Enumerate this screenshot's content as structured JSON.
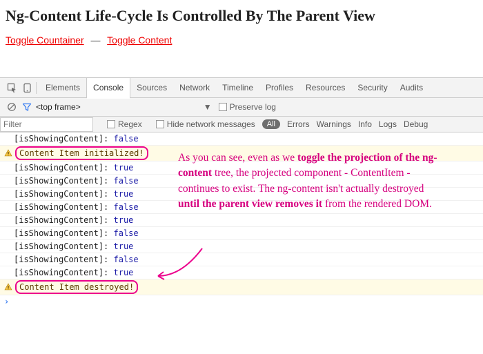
{
  "page": {
    "title": "Ng-Content Life-Cycle Is Controlled By The Parent View",
    "toggle_container": "Toggle Countainer",
    "separator": "—",
    "toggle_content": "Toggle Content"
  },
  "tabs": {
    "elements": "Elements",
    "console": "Console",
    "sources": "Sources",
    "network": "Network",
    "timeline": "Timeline",
    "profiles": "Profiles",
    "resources": "Resources",
    "security": "Security",
    "audits": "Audits"
  },
  "subbar": {
    "frame": "<top frame>",
    "preserve": "Preserve log"
  },
  "filterbar": {
    "placeholder": "Filter",
    "regex": "Regex",
    "hide": "Hide network messages",
    "all": "All",
    "errors": "Errors",
    "warnings": "Warnings",
    "info": "Info",
    "logs": "Logs",
    "debug": "Debug"
  },
  "console_lines": {
    "l0": "[isShowingContent]: false",
    "w1": "Content Item initialized!",
    "l2": "[isShowingContent]: true",
    "l3": "[isShowingContent]: false",
    "l4": "[isShowingContent]: true",
    "l5": "[isShowingContent]: false",
    "l6": "[isShowingContent]: true",
    "l7": "[isShowingContent]: false",
    "l8": "[isShowingContent]: true",
    "l9": "[isShowingContent]: false",
    "l10": "[isShowingContent]: true",
    "w11": "Content Item destroyed!"
  },
  "annotation": {
    "t1": "As you can see, even as we ",
    "b1": "toggle the projection of the ng-content",
    "t2": " tree, the projected component - ContentItem - continues to exist. The ng-content isn't actually destroyed ",
    "b2": "until the parent view removes it",
    "t3": " from the rendered DOM."
  }
}
